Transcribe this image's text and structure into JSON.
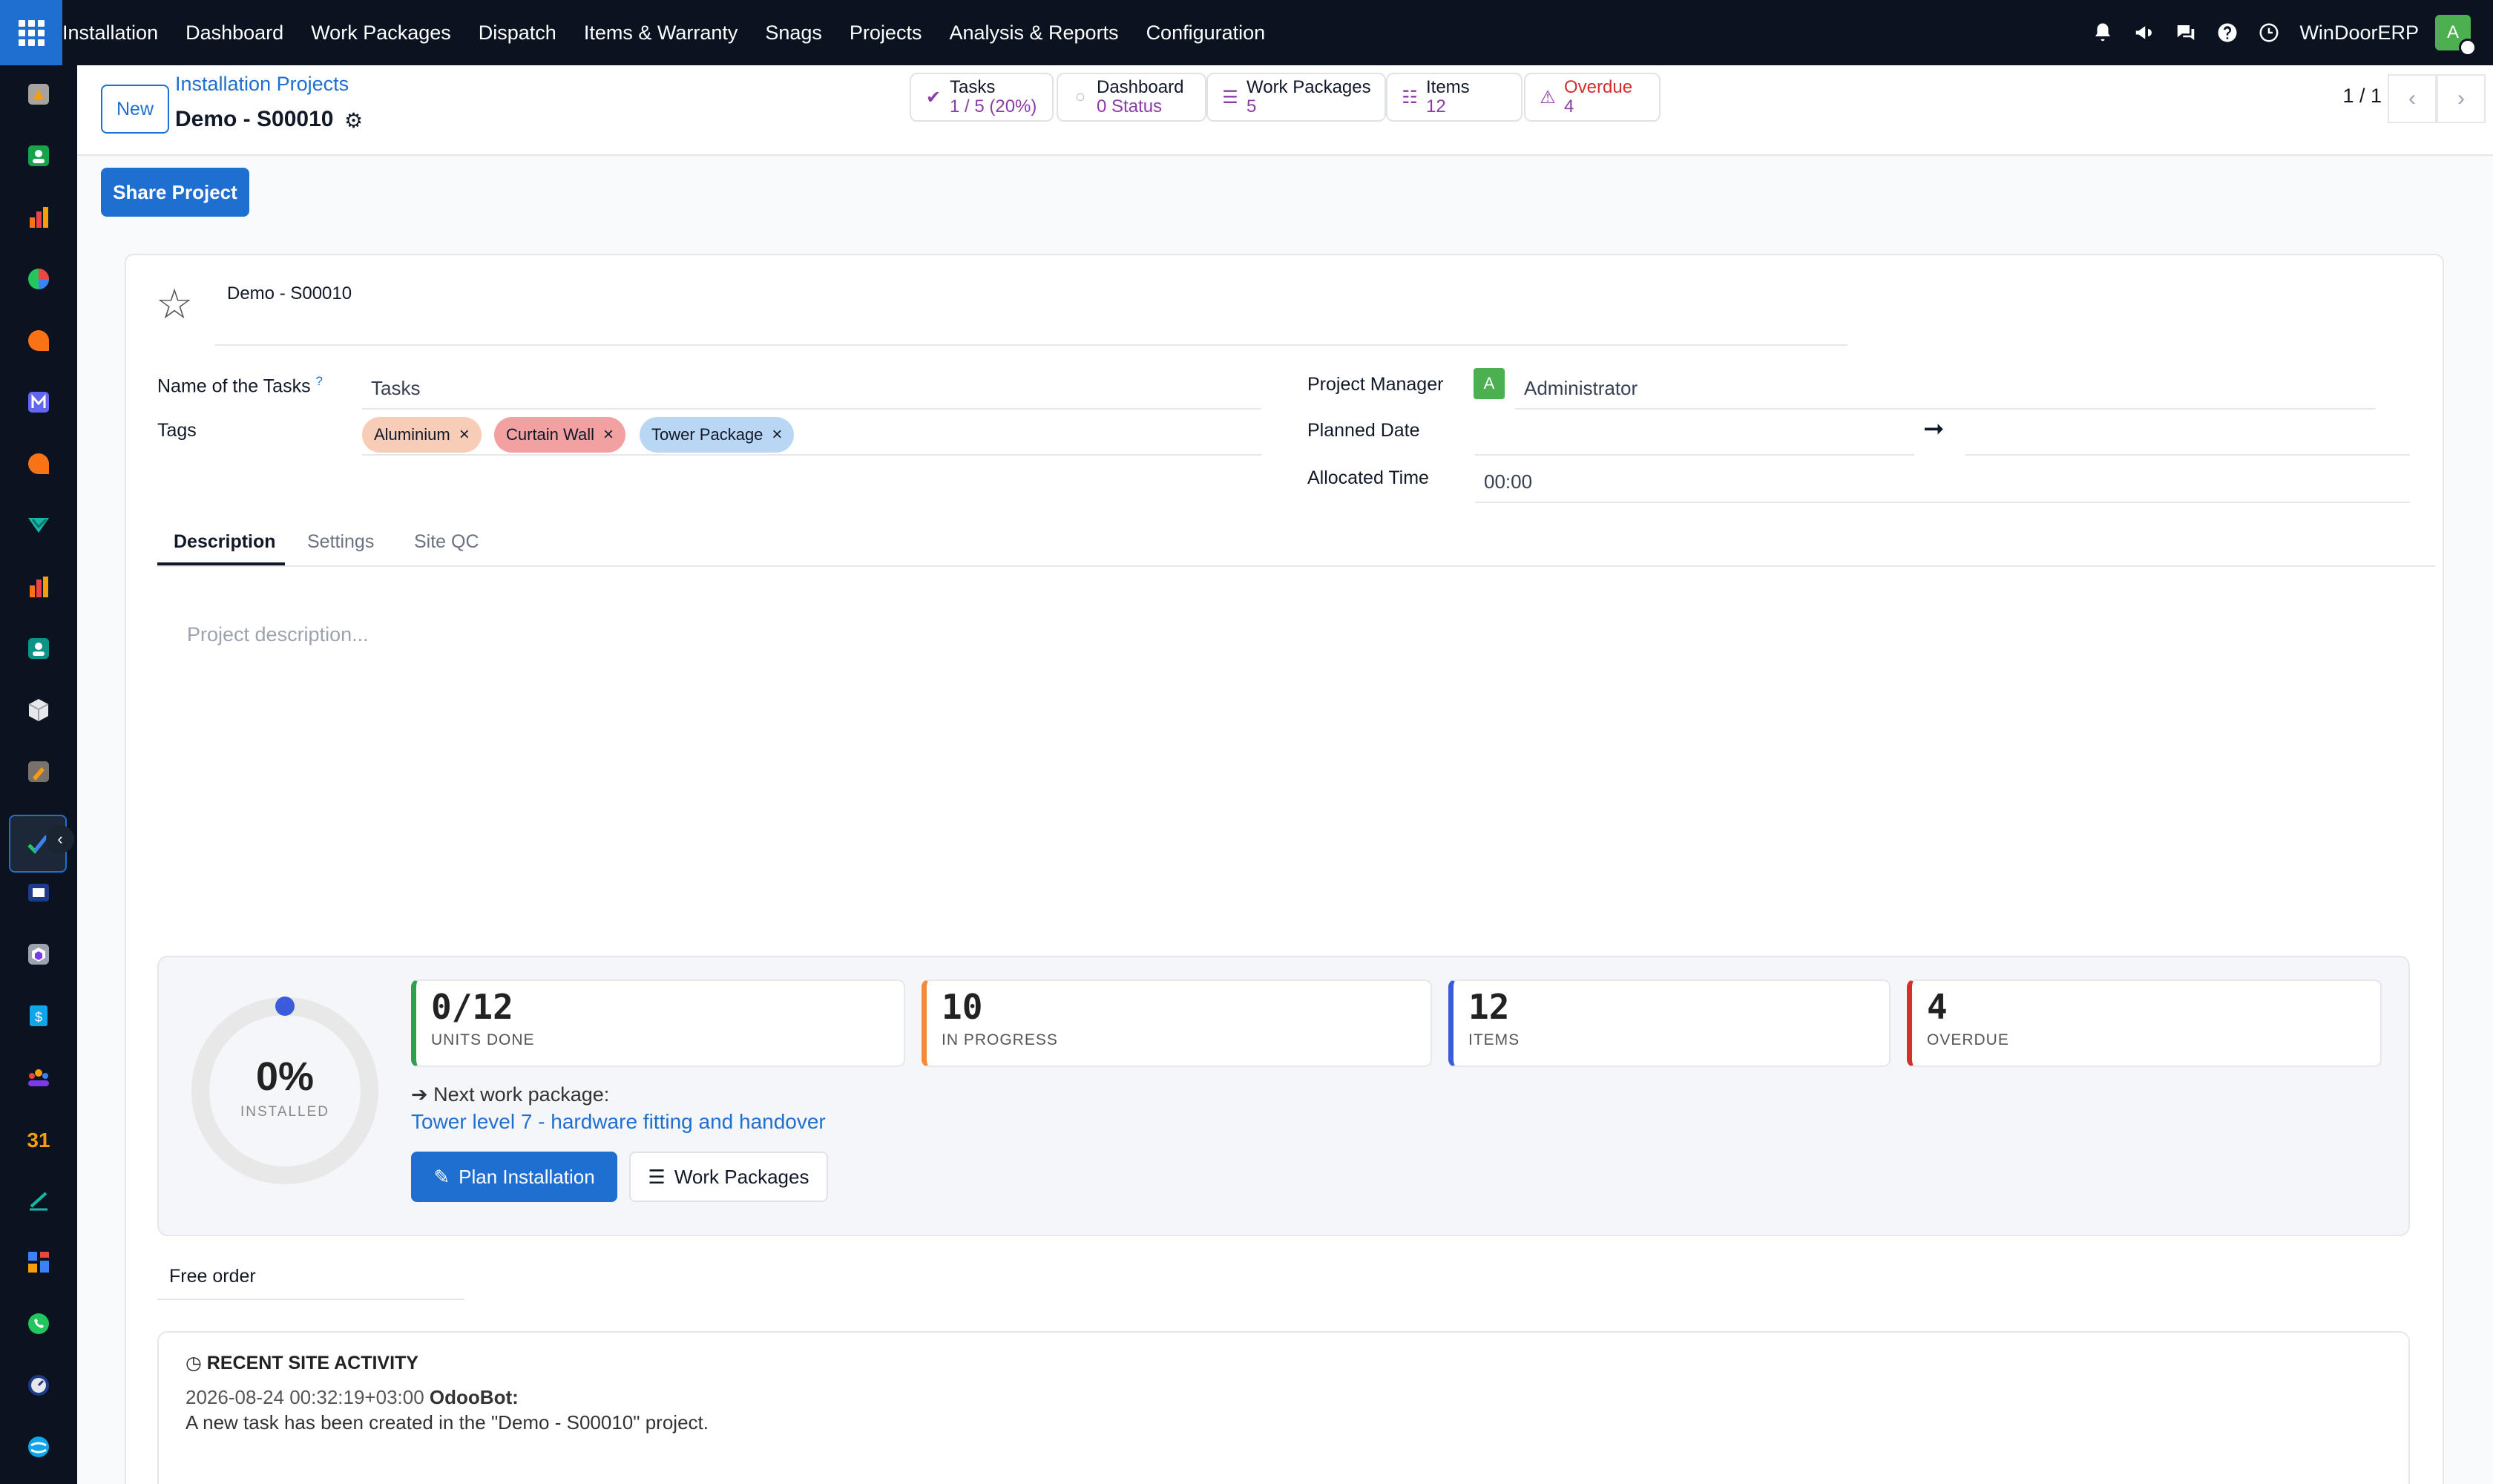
{
  "menu": {
    "items": [
      "Installation",
      "Dashboard",
      "Work Packages",
      "Dispatch",
      "Items & Warranty",
      "Snags",
      "Projects",
      "Analysis & Reports",
      "Configuration"
    ]
  },
  "topbar": {
    "company": "WinDoorERP",
    "avatar_letter": "A"
  },
  "control_panel": {
    "new_label": "New",
    "breadcrumb_parent": "Installation Projects",
    "record_title": "Demo - S00010",
    "pager": "1 / 1",
    "stat_buttons": [
      {
        "label": "Tasks",
        "value": "1 / 5 (20%)"
      },
      {
        "label": "Dashboard",
        "value": "0 Status"
      },
      {
        "label": "Work Packages",
        "value": "5"
      },
      {
        "label": "Items",
        "value": "12"
      },
      {
        "label": "Overdue",
        "value": "4"
      }
    ]
  },
  "share_label": "Share Project",
  "form": {
    "project_name": "Demo - S00010",
    "tasks_label": "Name of the Tasks",
    "tasks_help": "?",
    "tasks_value": "Tasks",
    "tags_label": "Tags",
    "tags": [
      "Aluminium",
      "Curtain Wall",
      "Tower Package"
    ],
    "pm_label": "Project Manager",
    "pm_avatar": "A",
    "pm_value": "Administrator",
    "planned_label": "Planned Date",
    "allocated_label": "Allocated Time",
    "allocated_value": "00:00"
  },
  "tabs": [
    "Description",
    "Settings",
    "Site QC"
  ],
  "description_placeholder": "Project description...",
  "dashboard": {
    "installed_fraction": 0,
    "percent_text": "0%",
    "installed_label": "INSTALLED",
    "cards": [
      {
        "value": "0/12",
        "label": "UNITS DONE",
        "color": "#2e9e4f"
      },
      {
        "value": "10",
        "label": "IN PROGRESS",
        "color": "#f08a3c"
      },
      {
        "value": "12",
        "label": "ITEMS",
        "color": "#3b5bdb"
      },
      {
        "value": "4",
        "label": "OVERDUE",
        "color": "#d32f2f"
      }
    ],
    "next_label": "Next work package:",
    "next_link": "Tower level 7 - hardware fitting and handover",
    "plan_label": "Plan Installation",
    "wp_label": "Work Packages"
  },
  "free_order": "Free order",
  "activity": {
    "title": "RECENT SITE ACTIVITY",
    "entries": [
      {
        "timestamp": "2026-08-24 00:32:19+03:00",
        "author": "OdooBot:",
        "text": "A new task has been created in the \"Demo - S00010\" project."
      }
    ]
  },
  "colors": {
    "topbar": "#0b1320",
    "brand": "#1f6fd1",
    "stat_value": "#8b3da6",
    "overdue": "#d32f2f",
    "tag_aluminium": "#f8cdb8",
    "tag_curtain_wall": "#f3a0a0",
    "tag_tower_package": "#b9d7f5"
  }
}
